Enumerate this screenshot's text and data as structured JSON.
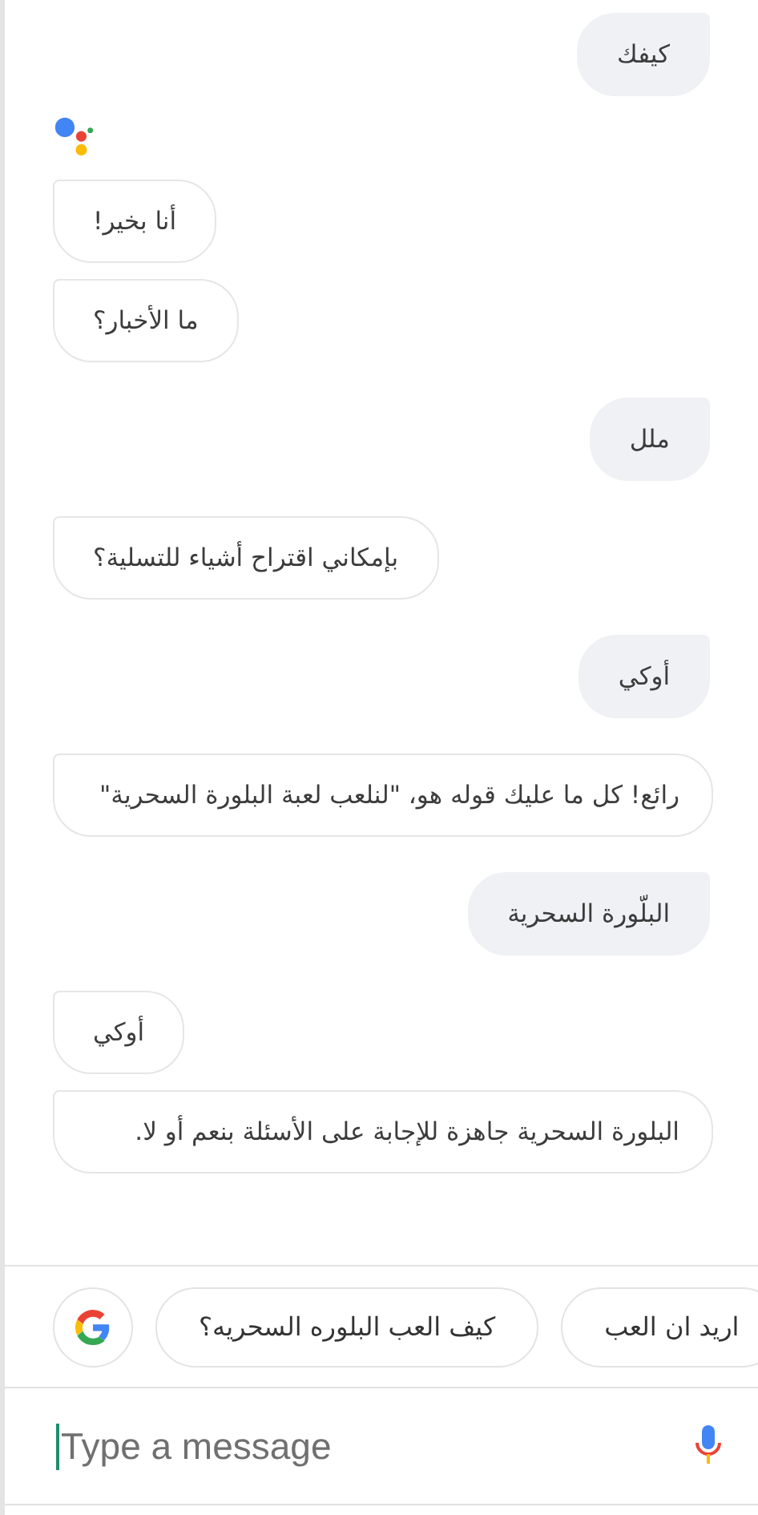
{
  "messages": [
    {
      "kind": "user",
      "text": "كيفك",
      "show_logo": false
    },
    {
      "kind": "assistant",
      "text": "أنا بخير!",
      "show_logo": true
    },
    {
      "kind": "assistant",
      "text": "ما الأخبار؟",
      "show_logo": false
    },
    {
      "kind": "user",
      "text": "ملل",
      "show_logo": false
    },
    {
      "kind": "assistant",
      "text": "بإمكاني اقتراح أشياء للتسلية؟",
      "show_logo": false
    },
    {
      "kind": "user",
      "text": "أوكي",
      "show_logo": false
    },
    {
      "kind": "assistant",
      "text": "رائع! كل ما عليك قوله هو، \"لنلعب لعبة البلورة السحرية\"",
      "show_logo": false
    },
    {
      "kind": "user",
      "text": "البلّورة السحرية",
      "show_logo": false
    },
    {
      "kind": "assistant",
      "text": "أوكي",
      "show_logo": false
    },
    {
      "kind": "assistant",
      "text": "البلورة السحرية جاهزة للإجابة على الأسئلة بنعم أو لا.",
      "show_logo": false
    }
  ],
  "suggestions": [
    "اريد ان العب",
    "كيف العب البلوره السحريه؟"
  ],
  "composer": {
    "placeholder": "Type a message"
  }
}
